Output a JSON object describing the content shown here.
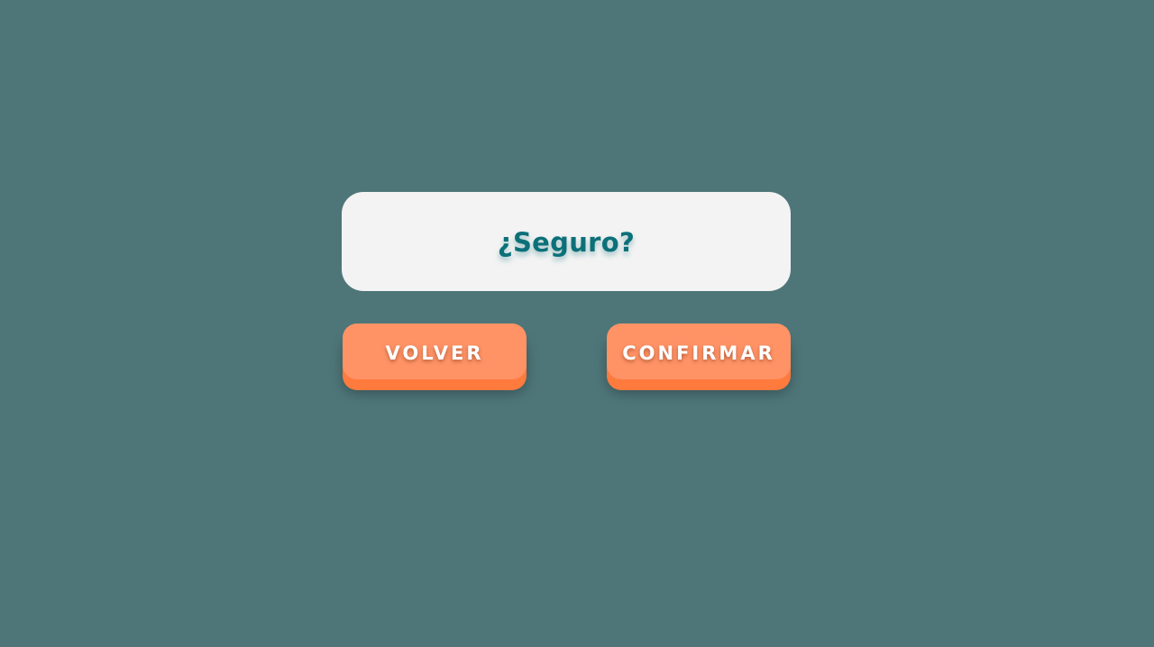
{
  "dialog": {
    "title": "¿Seguro?"
  },
  "actions": {
    "back_label": "VOLVER",
    "confirm_label": "CONFIRMAR"
  },
  "colors": {
    "background": "#4e7679",
    "card": "#f3f3f3",
    "title": "#0c7079",
    "button": "#ff9366",
    "button_edge": "#ff7a3d",
    "button_text": "#ffffff"
  }
}
